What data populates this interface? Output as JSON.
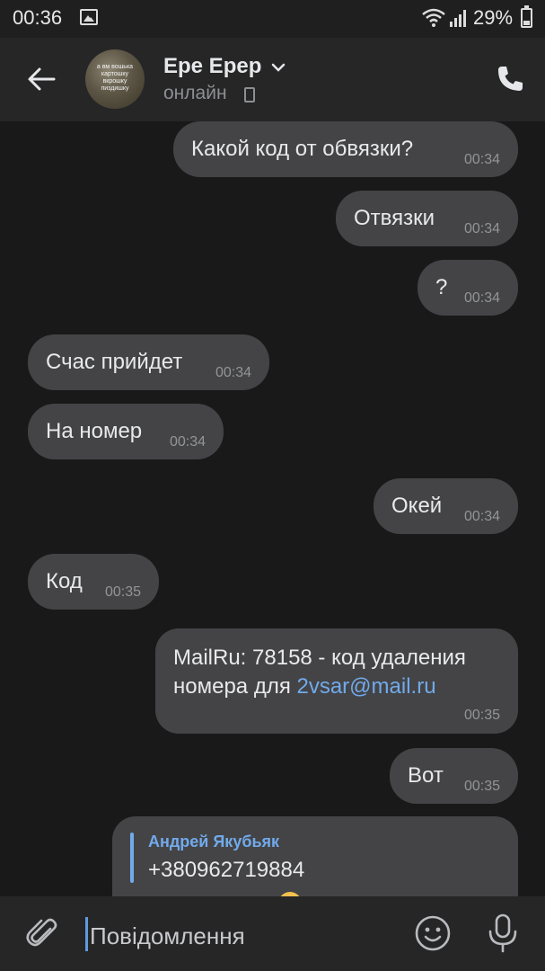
{
  "status_bar": {
    "time": "00:36",
    "battery": "29%",
    "battery_level": 0.29
  },
  "header": {
    "contact_name": "Ере Ерер",
    "contact_status": "онлайн",
    "avatar_caption": [
      "а вм вошька",
      "картошку",
      "вкрошку",
      "пиздишку"
    ]
  },
  "messages": [
    {
      "side": "out",
      "text": "Какой код от обвязки?",
      "time": "00:34"
    },
    {
      "side": "out",
      "text": "Отвязки",
      "time": "00:34"
    },
    {
      "side": "out",
      "text": "?",
      "time": "00:34"
    },
    {
      "side": "in",
      "text": "Счас прийдет",
      "time": "00:34"
    },
    {
      "side": "in",
      "text": "На номер",
      "time": "00:34"
    },
    {
      "side": "out",
      "text": "Окей",
      "time": "00:34"
    },
    {
      "side": "in",
      "text": "Код",
      "time": "00:35"
    },
    {
      "side": "out",
      "text_before_link": "MailRu: 78158 - код удаления номера для ",
      "link": "2vsar@mail.ru",
      "time": "00:35"
    },
    {
      "side": "out",
      "text": "Вот",
      "time": "00:35"
    },
    {
      "side": "out",
      "reply_author": "Андрей Якубьяк",
      "reply_text": "+380962719884"
    }
  ],
  "composer": {
    "placeholder": "Повідомлення"
  },
  "colors": {
    "background": "#19191a",
    "header": "#262627",
    "bubble": "#444446",
    "accent": "#71aaeb"
  },
  "icons": {
    "back": "arrow-left-icon",
    "call": "phone-icon",
    "attach": "paperclip-icon",
    "emoji": "smile-icon",
    "mic": "microphone-icon"
  }
}
